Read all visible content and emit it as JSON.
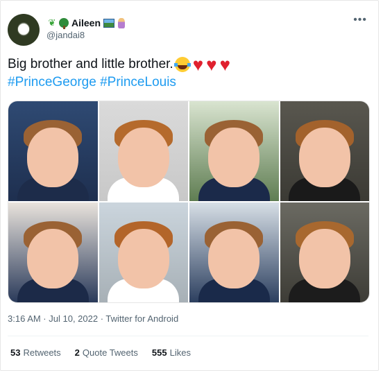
{
  "author": {
    "display_name": "Aileen",
    "handle": "@jandai8",
    "name_emojis": [
      "seedling-icon",
      "tree-icon",
      "landscape-icon",
      "fairy-icon"
    ]
  },
  "tweet": {
    "text": "Big brother and little brother.",
    "hashtags": "#PrinceGeorge #PrinceLouis",
    "emojis": [
      "face-with-tears-of-joy-icon",
      "red-heart-icon",
      "red-heart-icon",
      "red-heart-icon"
    ],
    "timestamp": "3:16 AM · Jul 10, 2022 · Twitter for Android"
  },
  "stats": {
    "retweets_count": "53",
    "retweets_label": "Retweets",
    "quotes_count": "2",
    "quotes_label": "Quote Tweets",
    "likes_count": "555",
    "likes_label": "Likes"
  },
  "colors": {
    "link": "#1d9bf0",
    "text": "#0f1419",
    "muted": "#536471",
    "heart": "#e0202e"
  }
}
